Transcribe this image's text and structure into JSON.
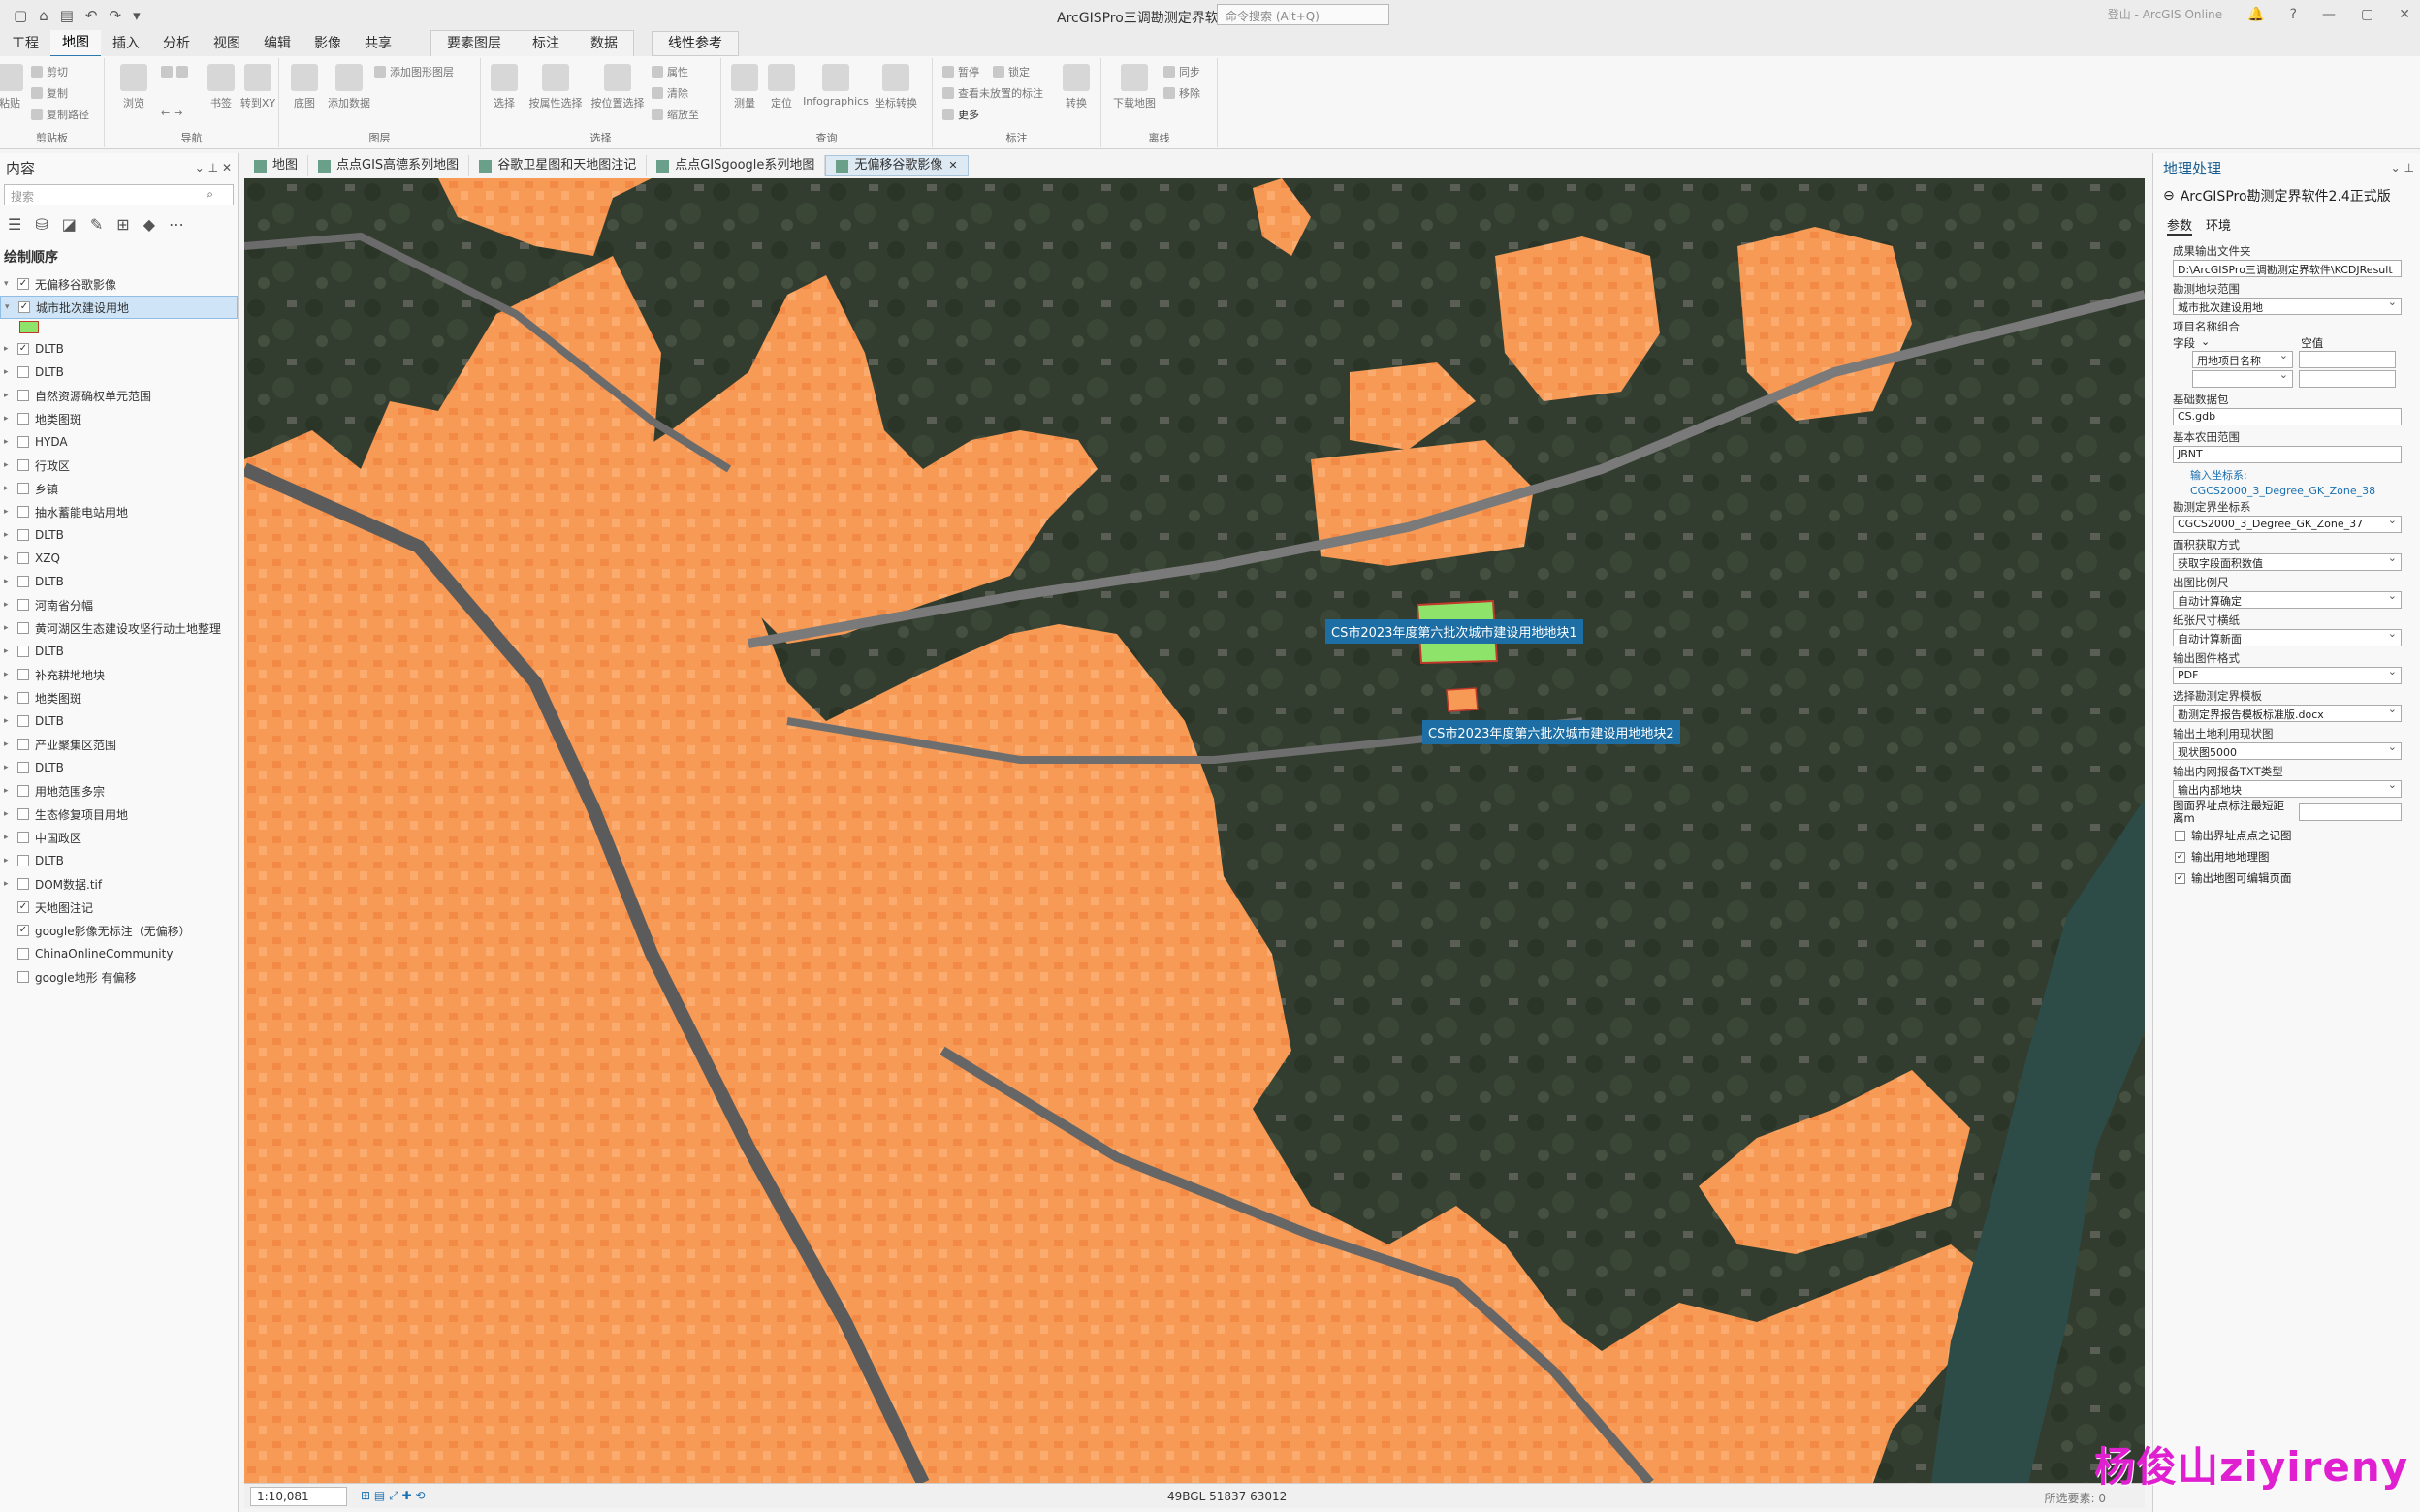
{
  "window": {
    "title": "ArcGISPro三调勘测定界软件",
    "command_search_placeholder": "命令搜索 (Alt+Q)",
    "user_label": "登山 - ArcGIS Online"
  },
  "ribbon": {
    "tabs": [
      "工程",
      "地图",
      "插入",
      "分析",
      "视图",
      "编辑",
      "影像",
      "共享"
    ],
    "context_tabs": [
      "要素图层",
      "标注",
      "数据"
    ],
    "context_tab2": "线性参考",
    "groups": {
      "clipboard": {
        "label": "剪贴板",
        "paste": "粘贴",
        "cut": "剪切",
        "copy": "复制",
        "copy_path": "复制路径"
      },
      "navigate": {
        "label": "导航",
        "explore": "浏览",
        "bookmarks": "书签",
        "goto_xy": "转到XY"
      },
      "layer": {
        "label": "图层",
        "basemap": "底图",
        "add_data": "添加数据",
        "add_graphics": "添加图形图层"
      },
      "selection": {
        "label": "选择",
        "select": "选择",
        "by_attr": "按属性选择",
        "by_loc": "按位置选择",
        "attributes": "属性",
        "clear": "清除",
        "zoom_to": "缩放至"
      },
      "inquiry": {
        "label": "查询",
        "measure": "测量",
        "locate": "定位",
        "infographics": "Infographics",
        "coord_convert": "坐标转换"
      },
      "labeling": {
        "label": "标注",
        "pause": "暂停",
        "lock": "锁定",
        "view_unplaced": "查看未放置的标注",
        "more": "更多",
        "convert": "转换"
      },
      "offline": {
        "label": "离线",
        "download_map": "下载地图",
        "sync": "同步",
        "remove": "移除"
      }
    }
  },
  "contents": {
    "title": "内容",
    "search_placeholder": "搜索",
    "drawing_order": "绘制顺序",
    "layers": [
      {
        "name": "无偏移谷歌影像",
        "checked": true,
        "expand": "▾",
        "selected": false,
        "indent": 0
      },
      {
        "name": "城市批次建设用地",
        "checked": true,
        "expand": "▾",
        "selected": true,
        "indent": 1
      },
      {
        "name": "DLTB",
        "checked": true,
        "expand": "▸",
        "selected": false,
        "indent": 1
      },
      {
        "name": "DLTB",
        "checked": false,
        "expand": "▸",
        "selected": false,
        "indent": 1
      },
      {
        "name": "自然资源确权单元范围",
        "checked": false,
        "expand": "▸",
        "selected": false,
        "indent": 1
      },
      {
        "name": "地类图斑",
        "checked": false,
        "expand": "▸",
        "selected": false,
        "indent": 1
      },
      {
        "name": "HYDA",
        "checked": false,
        "expand": "▸",
        "selected": false,
        "indent": 1
      },
      {
        "name": "行政区",
        "checked": false,
        "expand": "▸",
        "selected": false,
        "indent": 1
      },
      {
        "name": "乡镇",
        "checked": false,
        "expand": "▸",
        "selected": false,
        "indent": 1
      },
      {
        "name": "抽水蓄能电站用地",
        "checked": false,
        "expand": "▸",
        "selected": false,
        "indent": 1
      },
      {
        "name": "DLTB",
        "checked": false,
        "expand": "▸",
        "selected": false,
        "indent": 1
      },
      {
        "name": "XZQ",
        "checked": false,
        "expand": "▸",
        "selected": false,
        "indent": 1
      },
      {
        "name": "DLTB",
        "checked": false,
        "expand": "▸",
        "selected": false,
        "indent": 1
      },
      {
        "name": "河南省分幅",
        "checked": false,
        "expand": "▸",
        "selected": false,
        "indent": 1
      },
      {
        "name": "黄河湖区生态建设攻坚行动土地整理",
        "checked": false,
        "expand": "▸",
        "selected": false,
        "indent": 1
      },
      {
        "name": "DLTB",
        "checked": false,
        "expand": "▸",
        "selected": false,
        "indent": 1
      },
      {
        "name": "补充耕地地块",
        "checked": false,
        "expand": "▸",
        "selected": false,
        "indent": 1
      },
      {
        "name": "地类图斑",
        "checked": false,
        "expand": "▸",
        "selected": false,
        "indent": 1
      },
      {
        "name": "DLTB",
        "checked": false,
        "expand": "▸",
        "selected": false,
        "indent": 1
      },
      {
        "name": "产业聚集区范围",
        "checked": false,
        "expand": "▸",
        "selected": false,
        "indent": 1
      },
      {
        "name": "DLTB",
        "checked": false,
        "expand": "▸",
        "selected": false,
        "indent": 1
      },
      {
        "name": "用地范围多宗",
        "checked": false,
        "expand": "▸",
        "selected": false,
        "indent": 1
      },
      {
        "name": "生态修复项目用地",
        "checked": false,
        "expand": "▸",
        "selected": false,
        "indent": 1
      },
      {
        "name": "中国政区",
        "checked": false,
        "expand": "▸",
        "selected": false,
        "indent": 1
      },
      {
        "name": "DLTB",
        "checked": false,
        "expand": "▸",
        "selected": false,
        "indent": 1
      },
      {
        "name": "DOM数据.tif",
        "checked": false,
        "expand": "▸",
        "selected": false,
        "indent": 1
      },
      {
        "name": "天地图注记",
        "checked": true,
        "expand": "",
        "selected": false,
        "indent": 1
      },
      {
        "name": "google影像无标注（无偏移）",
        "checked": true,
        "expand": "",
        "selected": false,
        "indent": 1
      },
      {
        "name": "ChinaOnlineCommunity",
        "checked": false,
        "expand": "",
        "selected": false,
        "indent": 1
      },
      {
        "name": "google地形 有偏移",
        "checked": false,
        "expand": "",
        "selected": false,
        "indent": 1
      }
    ]
  },
  "map_tabs": [
    {
      "label": "地图",
      "active": false
    },
    {
      "label": "点点GIS高德系列地图",
      "active": false
    },
    {
      "label": "谷歌卫星图和天地图注记",
      "active": false
    },
    {
      "label": "点点GISgoogle系列地图",
      "active": false
    },
    {
      "label": "无偏移谷歌影像",
      "active": true
    }
  ],
  "map": {
    "labels": [
      "CS市2023年度第六批次城市建设用地地块1",
      "CS市2023年度第六批次城市建设用地地块2"
    ],
    "colors": {
      "urban_fill": "#f79a55",
      "parcel_fill": "#8ee36a",
      "label_bg": "#1c6ea4",
      "imagery_dark": "#2f3a2c"
    }
  },
  "status": {
    "scale": "1:10,081",
    "coordinates": "49BGL 51837 63012",
    "selected_features": "所选要素: 0"
  },
  "geoprocessing": {
    "title": "地理处理",
    "tool_title": "ArcGISPro勘测定界软件2.4正式版",
    "tabs": [
      "参数",
      "环境"
    ],
    "params": {
      "output_folder_label": "成果输出文件夹",
      "output_folder_value": "D:\\ArcGISPro三调勘测定界软件\\KCDJResult",
      "parcel_range_label": "勘测地块范围",
      "parcel_range_value": "城市批次建设用地",
      "project_name_label": "项目名称组合",
      "field_label": "字段",
      "null_label": "空值",
      "field_value": "用地项目名称",
      "base_db_label": "基础数据包",
      "base_db_value": "CS.gdb",
      "farmland_label": "基本农田范围",
      "farmland_value": "JBNT",
      "input_crs_label": "输入坐标系:",
      "input_crs_value": "CGCS2000_3_Degree_GK_Zone_38",
      "survey_crs_label": "勘测定界坐标系",
      "survey_crs_value": "CGCS2000_3_Degree_GK_Zone_37",
      "area_method_label": "面积获取方式",
      "area_method_value": "获取字段面积数值",
      "scale_label": "出图比例尺",
      "scale_value": "自动计算确定",
      "paper_label": "纸张尺寸横纸",
      "paper_value": "自动计算新面",
      "output_format_label": "输出图件格式",
      "output_format_value": "PDF",
      "template_label": "选择勘测定界模板",
      "template_value": "勘测定界报告模板标准版.docx",
      "landuse_map_label": "输出土地利用现状图",
      "landuse_map_value": "现状图5000",
      "txt_label": "输出内网报备TXT类型",
      "txt_value": "输出内部地块",
      "min_dist_label": "图面界址点标注最短距离m",
      "checks": [
        {
          "label": "输出界址点点之记图",
          "checked": false
        },
        {
          "label": "输出用地地理图",
          "checked": true
        },
        {
          "label": "输出地图可编辑页面",
          "checked": true
        }
      ]
    }
  },
  "watermark": "杨俊山ziyireny"
}
